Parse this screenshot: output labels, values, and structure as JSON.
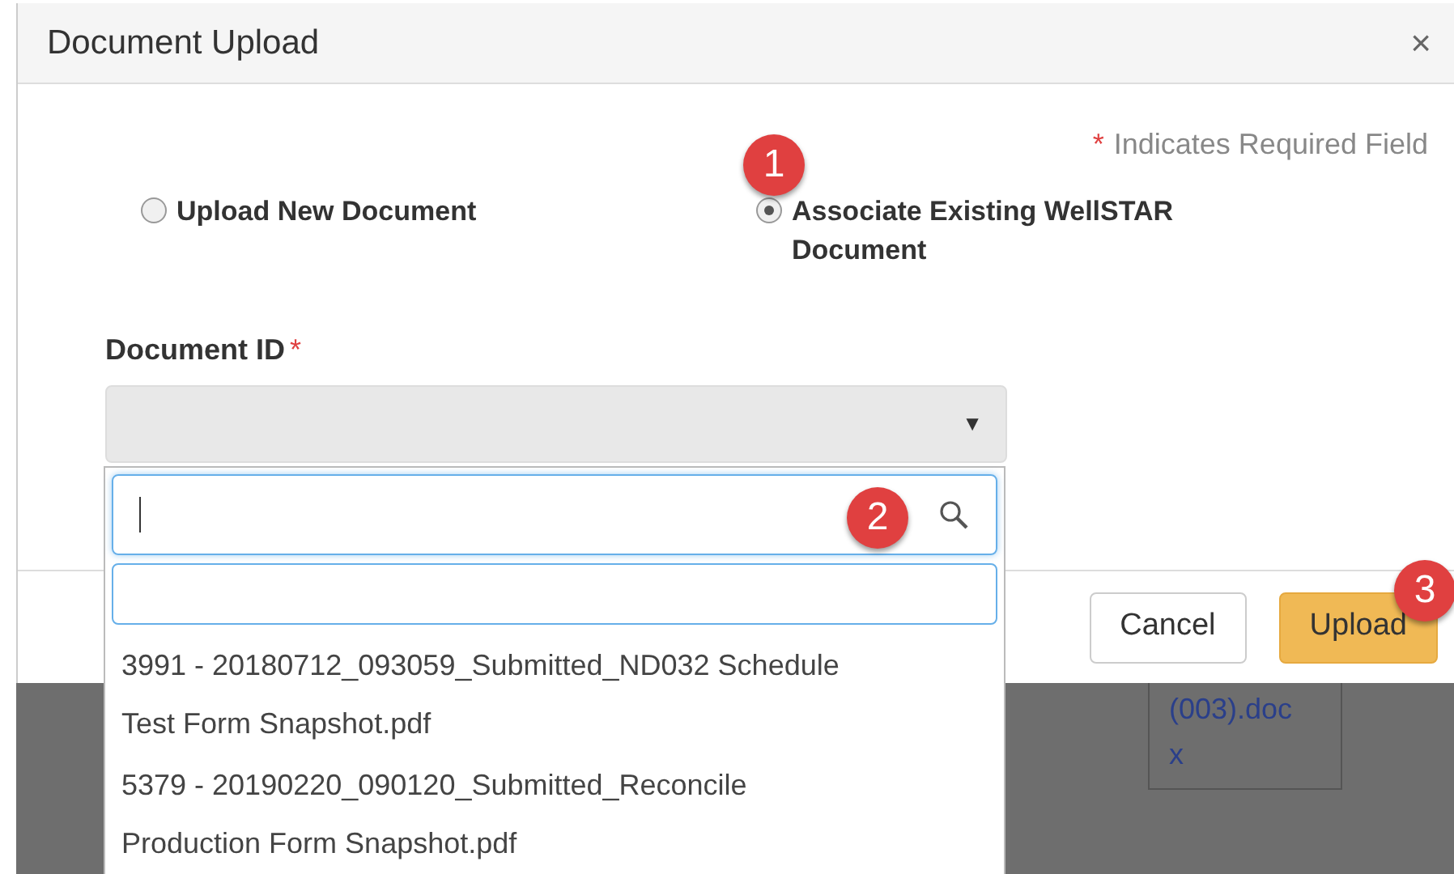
{
  "dialog": {
    "title": "Document Upload",
    "close": "×",
    "required_mark": "*",
    "required_note": "Indicates Required Field",
    "options": [
      {
        "label": "Upload New Document",
        "selected": false
      },
      {
        "label": "Associate Existing WellSTAR Document",
        "selected": true
      }
    ],
    "field": {
      "label": "Document ID",
      "required_mark": "*",
      "caret": "▼"
    },
    "buttons": [
      {
        "label": "Cancel",
        "kind": "default"
      },
      {
        "label": "Upload",
        "kind": "primary"
      }
    ]
  },
  "dropdown": {
    "items": [
      {
        "label": "3991 - 20180712_093059_Submitted_ND032 Schedule Test Form Snapshot.pdf"
      },
      {
        "label": "5379 - 20190220_090120_Submitted_Reconcile Production Form Snapshot.pdf"
      }
    ]
  },
  "background_table": {
    "cell": [
      "(003).doc",
      "x"
    ]
  },
  "callouts": [
    "1",
    "2",
    "3"
  ]
}
